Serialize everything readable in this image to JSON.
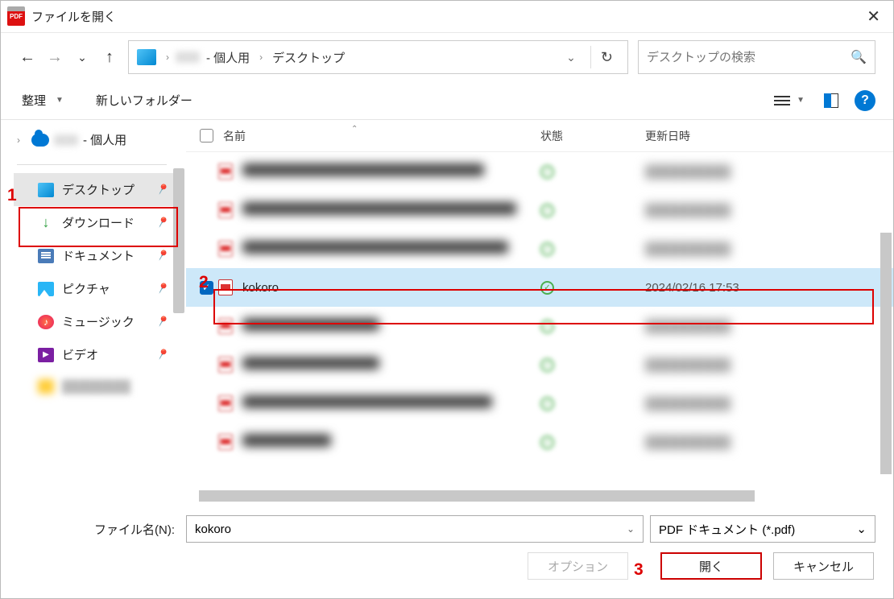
{
  "window": {
    "title": "ファイルを開く"
  },
  "nav": {
    "path": {
      "root_blur": " ",
      "root_suffix": " - 個人用",
      "current": "デスクトップ"
    }
  },
  "search": {
    "placeholder": "デスクトップの検索"
  },
  "toolbar": {
    "organize": "整理",
    "new_folder": "新しいフォルダー"
  },
  "sidebar": {
    "root_suffix": " - 個人用",
    "items": [
      {
        "label": "デスクトップ",
        "active": true
      },
      {
        "label": "ダウンロード"
      },
      {
        "label": "ドキュメント"
      },
      {
        "label": "ピクチャ"
      },
      {
        "label": "ミュージック"
      },
      {
        "label": "ビデオ"
      }
    ]
  },
  "columns": {
    "name": "名前",
    "status": "状態",
    "date": "更新日時"
  },
  "files": {
    "selected": {
      "name": "kokoro",
      "date": "2024/02/16 17:53"
    }
  },
  "footer": {
    "filename_label": "ファイル名(N):",
    "filename_value": "kokoro",
    "filetype": "PDF ドキュメント (*.pdf)",
    "options": "オプション",
    "open": "開く",
    "cancel": "キャンセル"
  },
  "annotations": {
    "a1": "1",
    "a2": "2",
    "a3": "3"
  }
}
